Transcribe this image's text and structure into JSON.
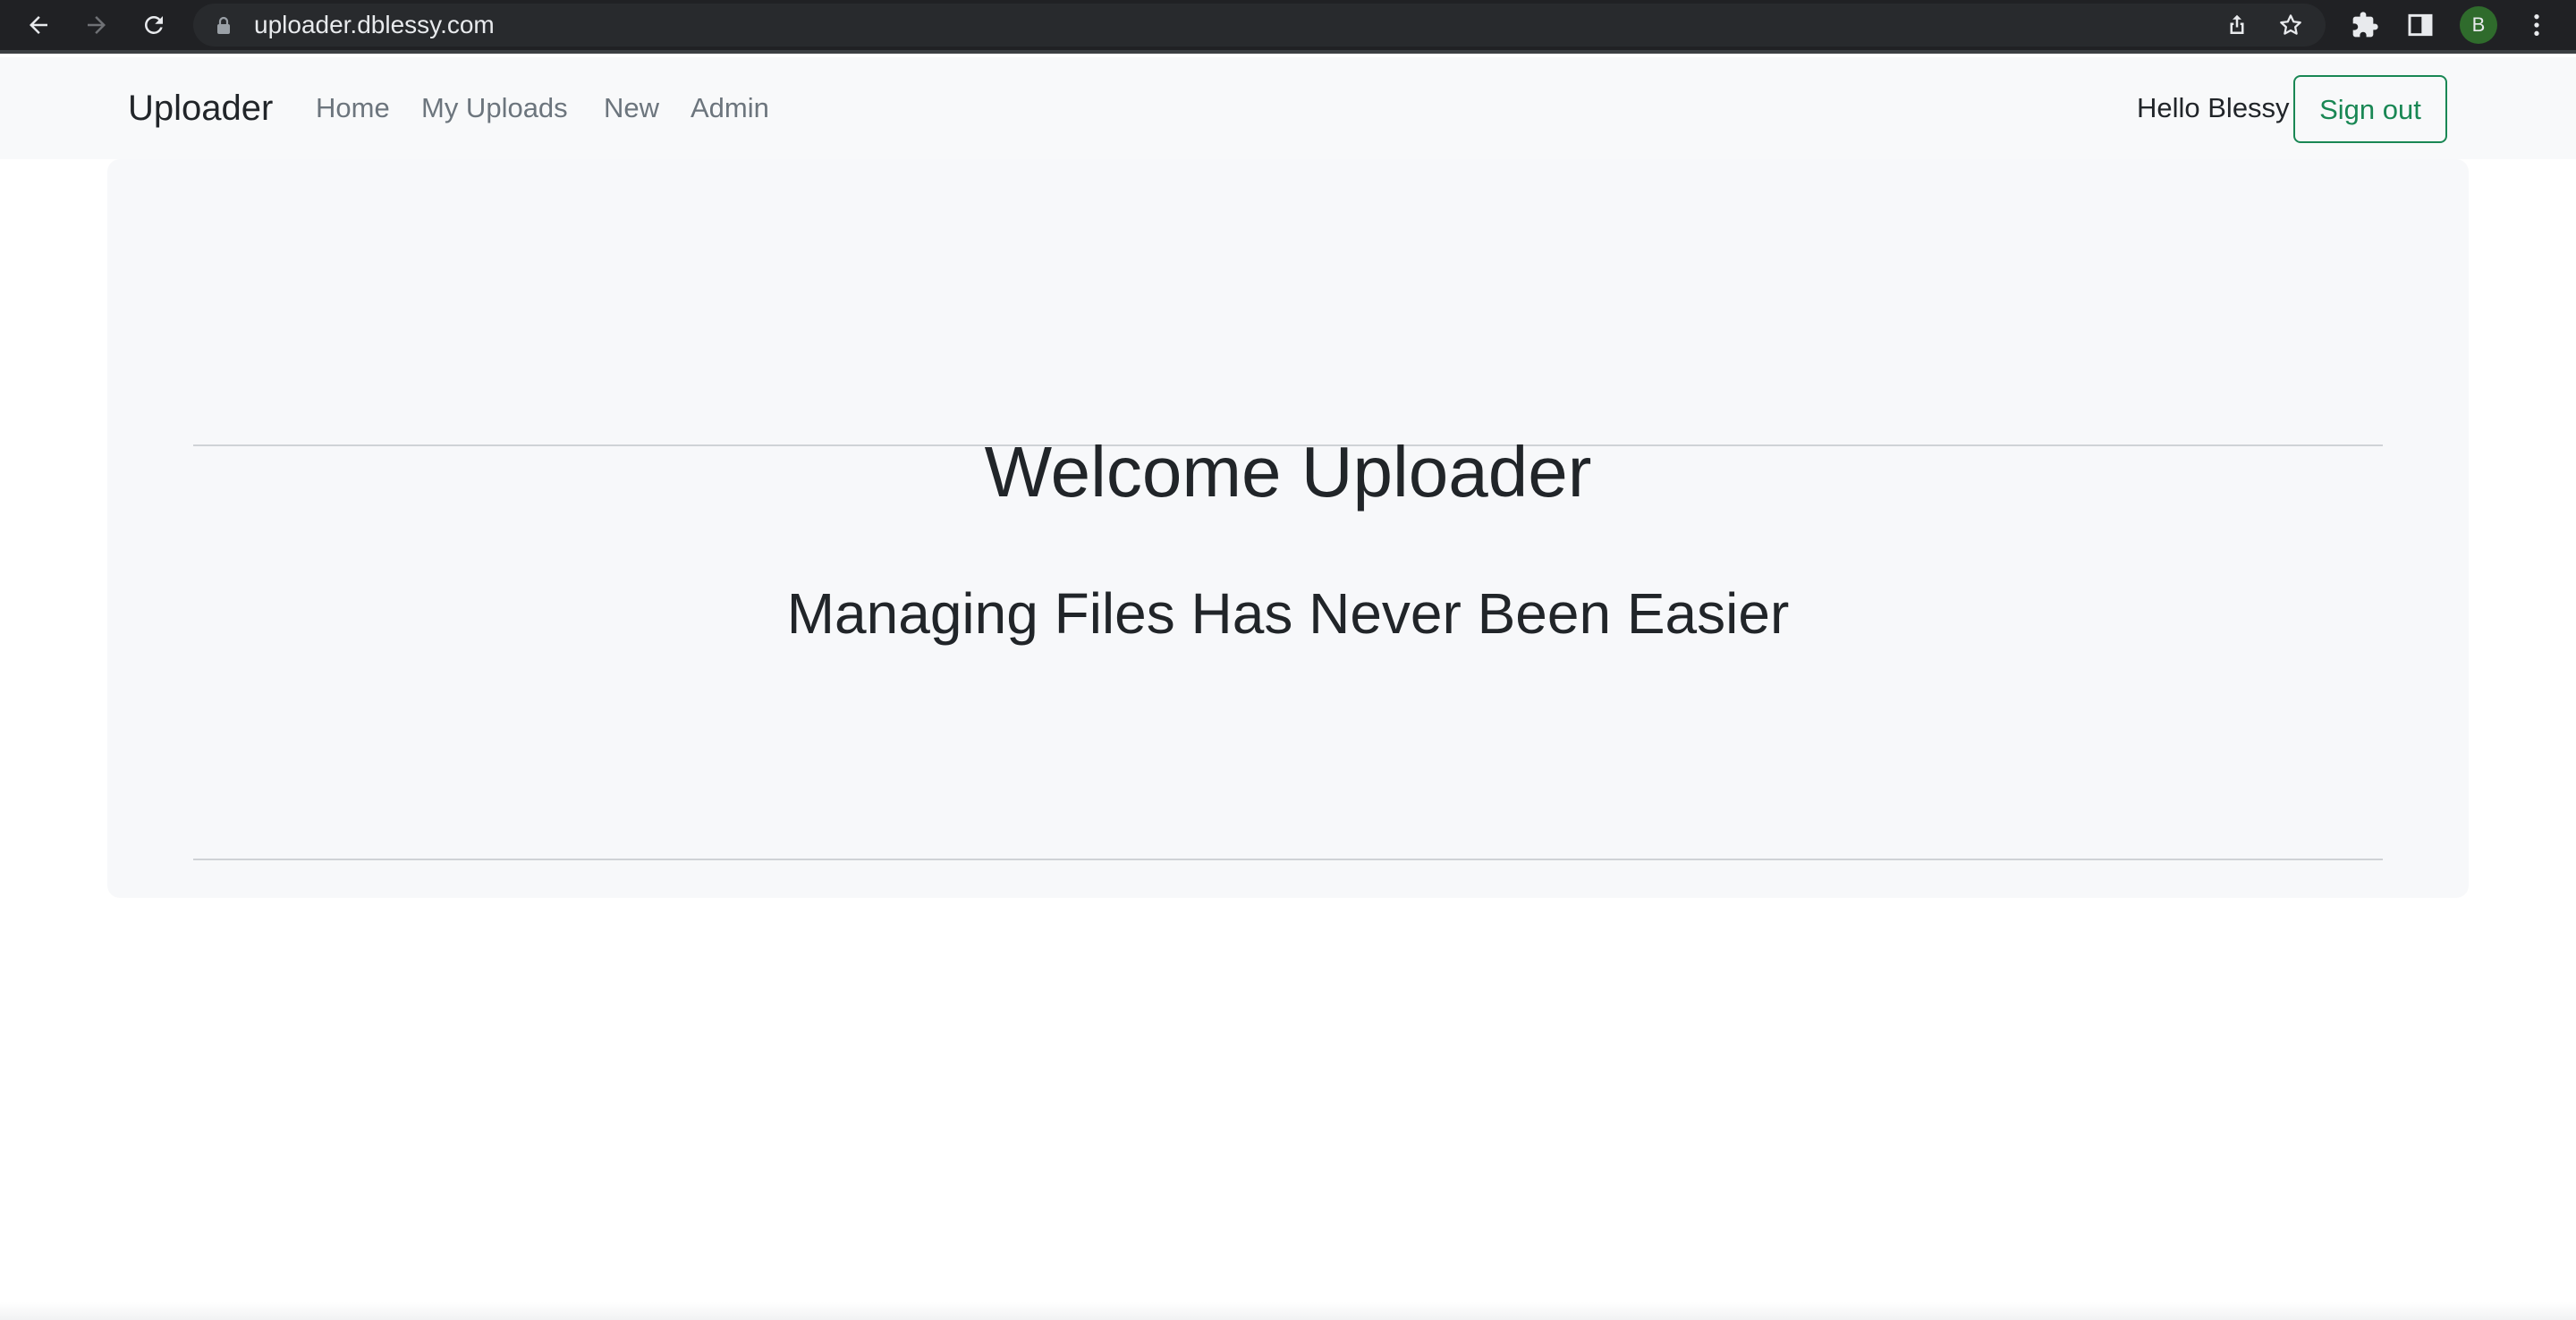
{
  "browser": {
    "url": "uploader.dblessy.com",
    "profile_initial": "B",
    "icons": {
      "back": "back-arrow-icon",
      "forward": "forward-arrow-icon",
      "reload": "reload-icon",
      "lock": "lock-icon",
      "share": "share-icon",
      "bookmark": "star-icon",
      "extensions": "puzzle-icon",
      "side_panel": "side-panel-icon",
      "menu": "kebab-menu-icon"
    },
    "colors": {
      "chrome_bg": "#202124",
      "omnibox_bg": "#282a2d",
      "avatar_bg": "#2f6b2c"
    }
  },
  "navbar": {
    "brand": "Uploader",
    "links": [
      {
        "label": "Home"
      },
      {
        "label": "My Uploads"
      },
      {
        "label": "New"
      },
      {
        "label": "Admin"
      }
    ],
    "greeting": "Hello Blessy",
    "signout_label": "Sign out",
    "colors": {
      "background": "#f8f9fa",
      "link": "#6c757d",
      "signout": "#198754"
    }
  },
  "hero": {
    "title": "Welcome Uploader",
    "subtitle": "Managing Files Has Never Been Easier",
    "colors": {
      "background": "#f7f8fa",
      "text": "#212529"
    }
  }
}
